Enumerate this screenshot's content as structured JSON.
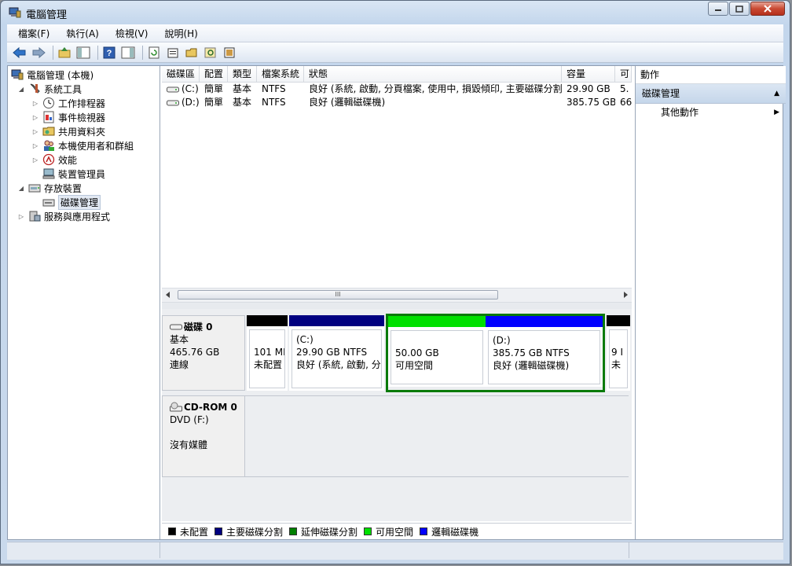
{
  "window": {
    "title": "電腦管理"
  },
  "menu": [
    "檔案(F)",
    "執行(A)",
    "檢視(V)",
    "說明(H)"
  ],
  "toolbar_icons": [
    "back-icon",
    "forward-icon",
    "up-folder-icon",
    "show-hide-tree-icon",
    "help-icon",
    "show-hide-action-icon",
    "refresh-icon",
    "properties-icon",
    "open-icon",
    "search-icon",
    "export-icon"
  ],
  "tree": {
    "root": "電腦管理 (本機)",
    "items": [
      {
        "label": "系統工具"
      },
      {
        "label": "工作排程器"
      },
      {
        "label": "事件檢視器"
      },
      {
        "label": "共用資料夾"
      },
      {
        "label": "本機使用者和群組"
      },
      {
        "label": "效能"
      },
      {
        "label": "裝置管理員"
      },
      {
        "label": "存放裝置"
      },
      {
        "label": "磁碟管理"
      },
      {
        "label": "服務與應用程式"
      }
    ]
  },
  "volumes": {
    "columns": [
      "磁碟區",
      "配置",
      "類型",
      "檔案系統",
      "狀態",
      "容量",
      "可"
    ],
    "rows": [
      {
        "vol": "(C:)",
        "layout": "簡單",
        "type": "基本",
        "fs": "NTFS",
        "status": "良好 (系統, 啟動, 分頁檔案, 使用中, 損毀傾印, 主要磁碟分割)",
        "capacity": "29.90 GB",
        "free": "5."
      },
      {
        "vol": "(D:)",
        "layout": "簡單",
        "type": "基本",
        "fs": "NTFS",
        "status": "良好 (邏輯磁碟機)",
        "capacity": "385.75 GB",
        "free": "66"
      }
    ],
    "scroll_thumb": "III"
  },
  "disk0": {
    "name": "磁碟 0",
    "kind": "基本",
    "size": "465.76 GB",
    "state": "連線",
    "partitions": [
      {
        "line1": "",
        "line2": "101 MI",
        "line3": "未配置",
        "color": "#000000"
      },
      {
        "line1": "(C:)",
        "line2": "29.90 GB NTFS",
        "line3": "良好 (系統, 啟動, 分",
        "color": "#000080"
      },
      {
        "line1": "",
        "line2": "50.00 GB",
        "line3": "可用空間",
        "color": "#00e000"
      },
      {
        "line1": "(D:)",
        "line2": "385.75 GB NTFS",
        "line3": "良好 (邏輯磁碟機)",
        "color": "#0000ff"
      },
      {
        "line1": "",
        "line2": "9 I",
        "line3": "未",
        "color": "#000000"
      }
    ]
  },
  "cdrom0": {
    "name": "CD-ROM 0",
    "kind": "DVD (F:)",
    "state": "沒有媒體"
  },
  "legend": [
    {
      "label": "未配置",
      "color": "#000000"
    },
    {
      "label": "主要磁碟分割",
      "color": "#000080"
    },
    {
      "label": "延伸磁碟分割",
      "color": "#008000"
    },
    {
      "label": "可用空間",
      "color": "#00e000"
    },
    {
      "label": "邏輯磁碟機",
      "color": "#0000ff"
    }
  ],
  "actions": {
    "header": "動作",
    "section": "磁碟管理",
    "more": "其他動作"
  }
}
